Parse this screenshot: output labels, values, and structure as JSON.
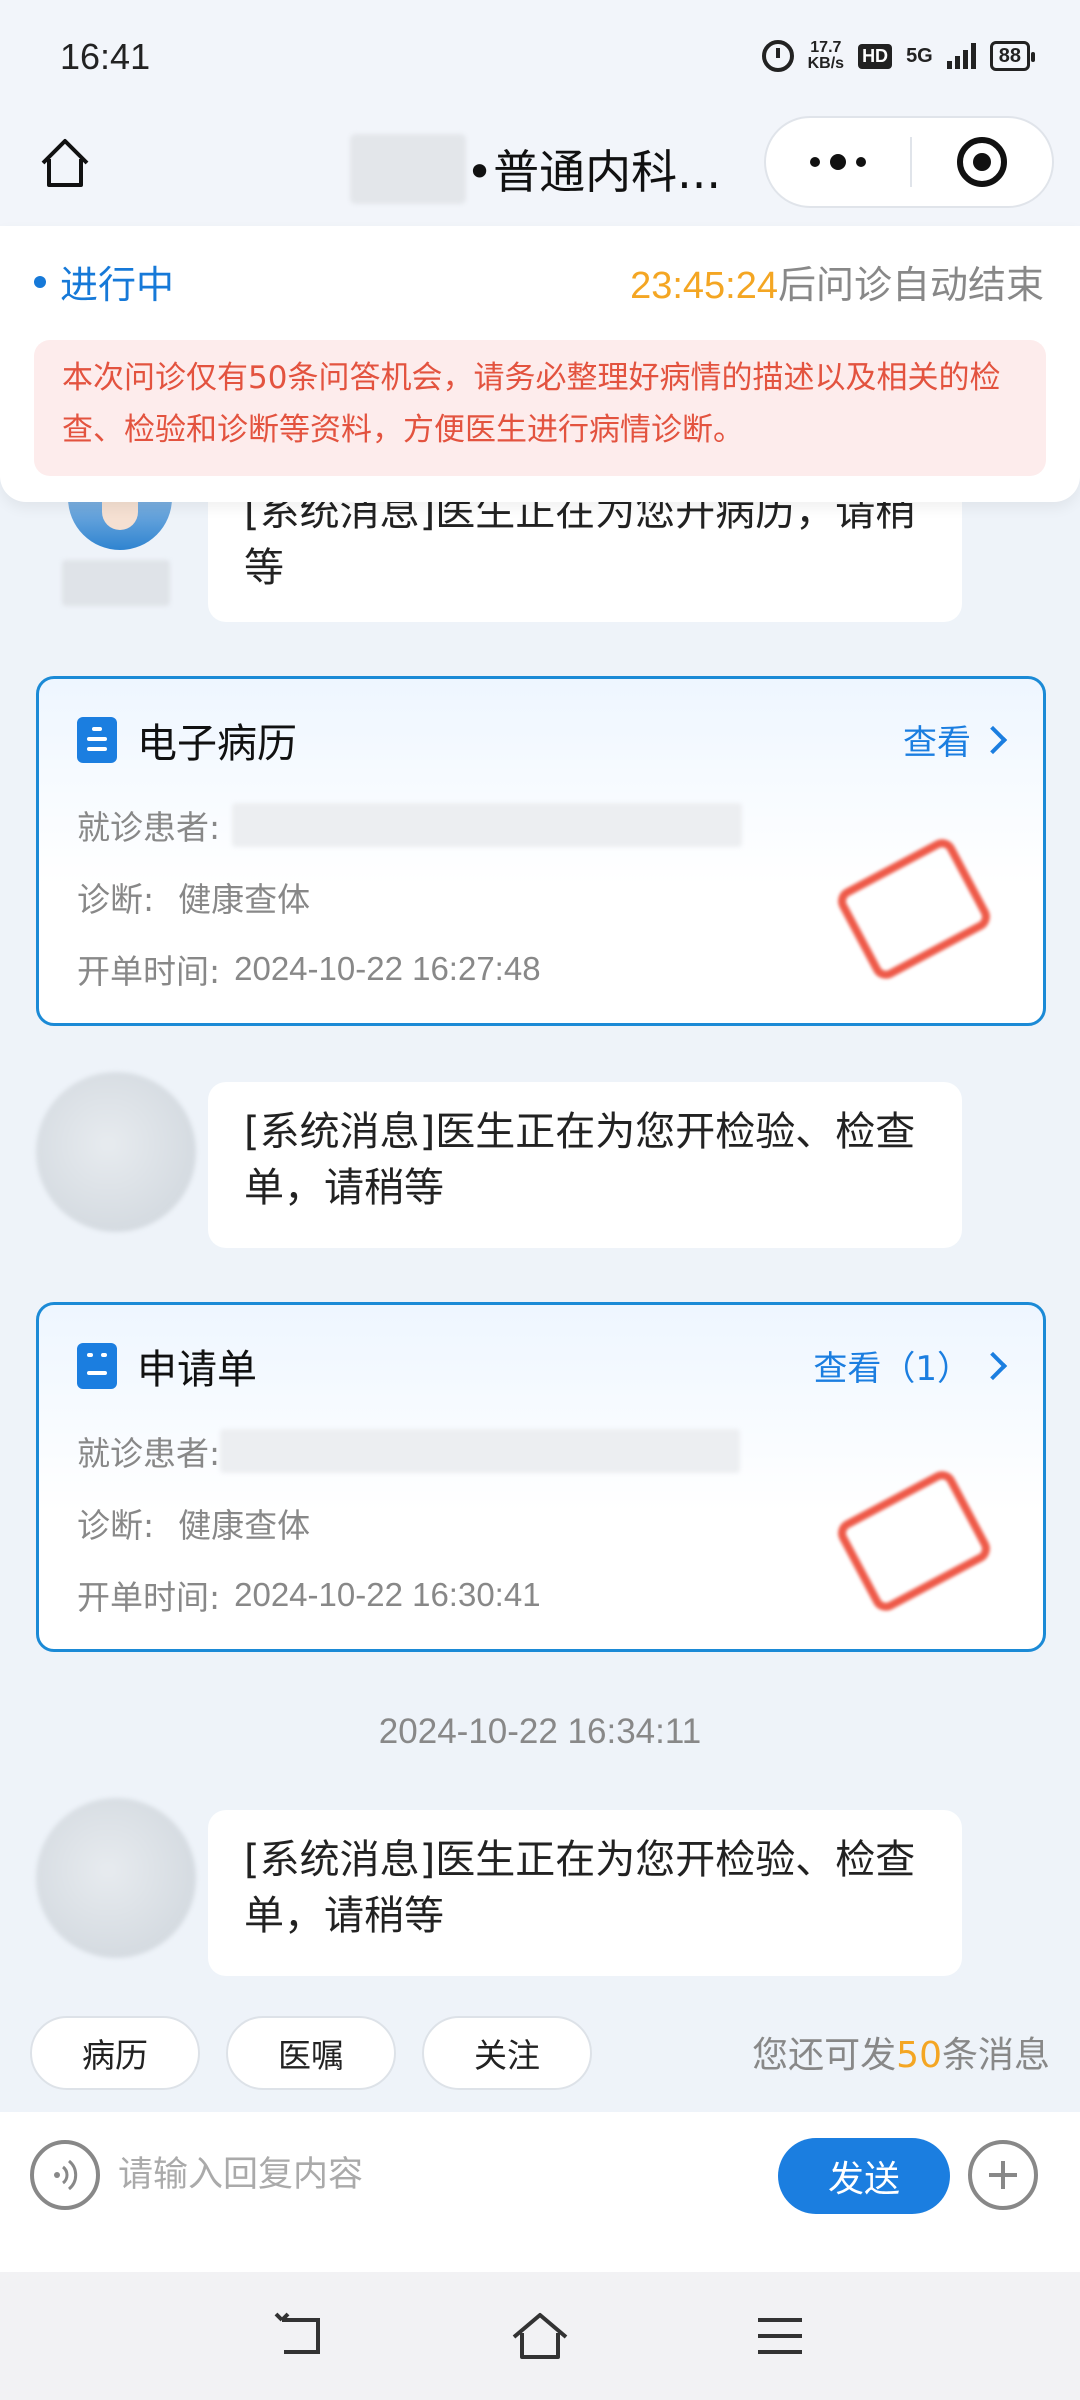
{
  "status_bar": {
    "time": "16:41",
    "net_speed_value": "17.7",
    "net_speed_unit": "KB/s",
    "hd": "HD",
    "network": "5G",
    "battery": "88"
  },
  "nav": {
    "title": "•普通内科..."
  },
  "consult_status": {
    "state": "进行中",
    "countdown": "23:45:24",
    "countdown_suffix": "后问诊自动结束",
    "warning": "本次问诊仅有50条问答机会，请务必整理好病情的描述以及相关的检查、检验和诊断等资料，方便医生进行病情诊断。"
  },
  "messages": {
    "m1": "[系统消息]医生正在为您开病历，请稍等",
    "m2": "[系统消息]医生正在为您开检验、检查单，请稍等",
    "m3": "[系统消息]医生正在为您开检验、检查单，请稍等",
    "timestamp": "2024-10-22 16:34:11"
  },
  "record_card": {
    "title": "电子病历",
    "view": "查看",
    "patient_label": "就诊患者:",
    "diagnosis_label": "诊断:",
    "diagnosis": "健康查体",
    "time_label": "开单时间:",
    "time": "2024-10-22 16:27:48"
  },
  "request_card": {
    "title": "申请单",
    "view": "查看（1）",
    "patient_label": "就诊患者:",
    "diagnosis_label": "诊断:",
    "diagnosis": "健康查体",
    "time_label": "开单时间:",
    "time": "2024-10-22 16:30:41"
  },
  "quick_actions": [
    "病历",
    "医嘱",
    "关注"
  ],
  "remaining": {
    "prefix": "您还可发",
    "count": "50",
    "suffix": "条消息"
  },
  "input": {
    "placeholder": "请输入回复内容",
    "send": "发送"
  },
  "colors": {
    "accent": "#1b7ee0",
    "countdown": "#f4a623",
    "warning_text": "#e3533f",
    "warning_bg": "#fdecec"
  }
}
